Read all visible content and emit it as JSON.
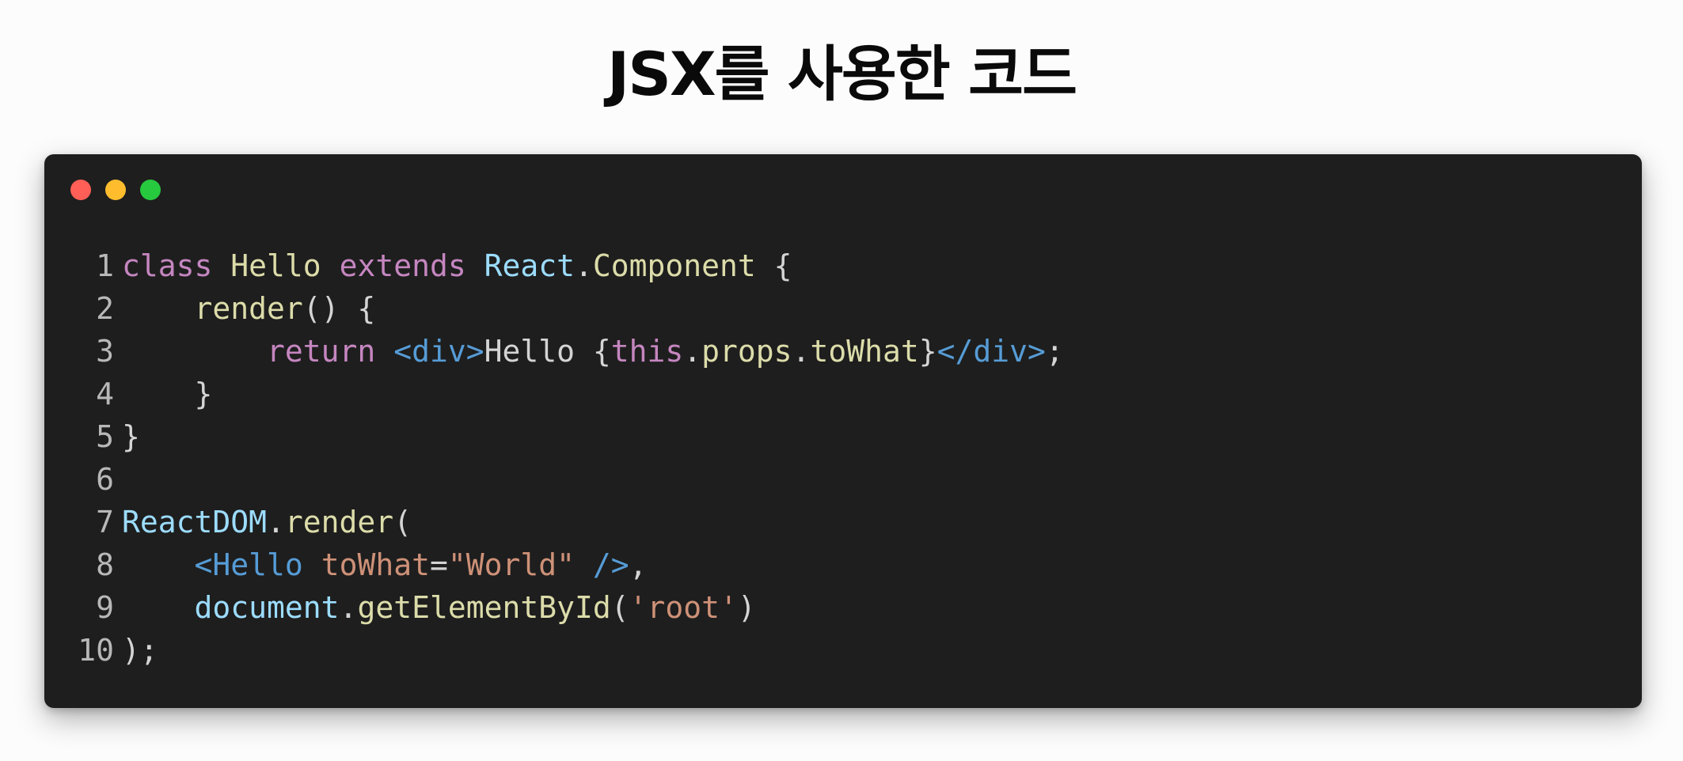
{
  "title": "JSX를 사용한 코드",
  "window": {
    "traffic_lights": [
      {
        "name": "close",
        "color": "#ff5f56"
      },
      {
        "name": "minimize",
        "color": "#ffbd2e"
      },
      {
        "name": "maximize",
        "color": "#27c93f"
      }
    ]
  },
  "colors": {
    "keyword": "#c586c0",
    "type": "#9cdcfe",
    "class_name": "#dcdcaa",
    "function": "#dcdcaa",
    "jsx_tag": "#569cd6",
    "jsx_attr": "#ce9178",
    "string": "#ce9178",
    "plain": "#d4d4d4",
    "line_number": "#b8b8b8"
  },
  "code_lines": [
    {
      "n": "1",
      "tokens": [
        {
          "t": "class",
          "c": "keyword"
        },
        {
          "t": " ",
          "c": "plain"
        },
        {
          "t": "Hello",
          "c": "class_name"
        },
        {
          "t": " ",
          "c": "plain"
        },
        {
          "t": "extends",
          "c": "keyword"
        },
        {
          "t": " ",
          "c": "plain"
        },
        {
          "t": "React",
          "c": "type"
        },
        {
          "t": ".",
          "c": "plain"
        },
        {
          "t": "Component",
          "c": "class_name"
        },
        {
          "t": " {",
          "c": "plain"
        }
      ]
    },
    {
      "n": "2",
      "tokens": [
        {
          "t": "    ",
          "c": "plain"
        },
        {
          "t": "render",
          "c": "function"
        },
        {
          "t": "() {",
          "c": "plain"
        }
      ]
    },
    {
      "n": "3",
      "tokens": [
        {
          "t": "        ",
          "c": "plain"
        },
        {
          "t": "return",
          "c": "keyword"
        },
        {
          "t": " ",
          "c": "plain"
        },
        {
          "t": "<div>",
          "c": "jsx_tag"
        },
        {
          "t": "Hello {",
          "c": "plain"
        },
        {
          "t": "this",
          "c": "keyword"
        },
        {
          "t": ".",
          "c": "plain"
        },
        {
          "t": "props",
          "c": "function"
        },
        {
          "t": ".",
          "c": "plain"
        },
        {
          "t": "toWhat",
          "c": "function"
        },
        {
          "t": "}",
          "c": "plain"
        },
        {
          "t": "</div>",
          "c": "jsx_tag"
        },
        {
          "t": ";",
          "c": "plain"
        }
      ]
    },
    {
      "n": "4",
      "tokens": [
        {
          "t": "    }",
          "c": "plain"
        }
      ]
    },
    {
      "n": "5",
      "tokens": [
        {
          "t": "}",
          "c": "plain"
        }
      ]
    },
    {
      "n": "6",
      "tokens": []
    },
    {
      "n": "7",
      "tokens": [
        {
          "t": "ReactDOM",
          "c": "type"
        },
        {
          "t": ".",
          "c": "plain"
        },
        {
          "t": "render",
          "c": "function"
        },
        {
          "t": "(",
          "c": "plain"
        }
      ]
    },
    {
      "n": "8",
      "tokens": [
        {
          "t": "    ",
          "c": "plain"
        },
        {
          "t": "<Hello",
          "c": "jsx_tag"
        },
        {
          "t": " ",
          "c": "plain"
        },
        {
          "t": "toWhat",
          "c": "jsx_attr"
        },
        {
          "t": "=",
          "c": "plain"
        },
        {
          "t": "\"World\"",
          "c": "string"
        },
        {
          "t": " ",
          "c": "plain"
        },
        {
          "t": "/>",
          "c": "jsx_tag"
        },
        {
          "t": ",",
          "c": "plain"
        }
      ]
    },
    {
      "n": "9",
      "tokens": [
        {
          "t": "    ",
          "c": "plain"
        },
        {
          "t": "document",
          "c": "type"
        },
        {
          "t": ".",
          "c": "plain"
        },
        {
          "t": "getElementById",
          "c": "function"
        },
        {
          "t": "(",
          "c": "plain"
        },
        {
          "t": "'root'",
          "c": "string"
        },
        {
          "t": ")",
          "c": "plain"
        }
      ]
    },
    {
      "n": "10",
      "tokens": [
        {
          "t": ");",
          "c": "plain"
        }
      ]
    }
  ]
}
